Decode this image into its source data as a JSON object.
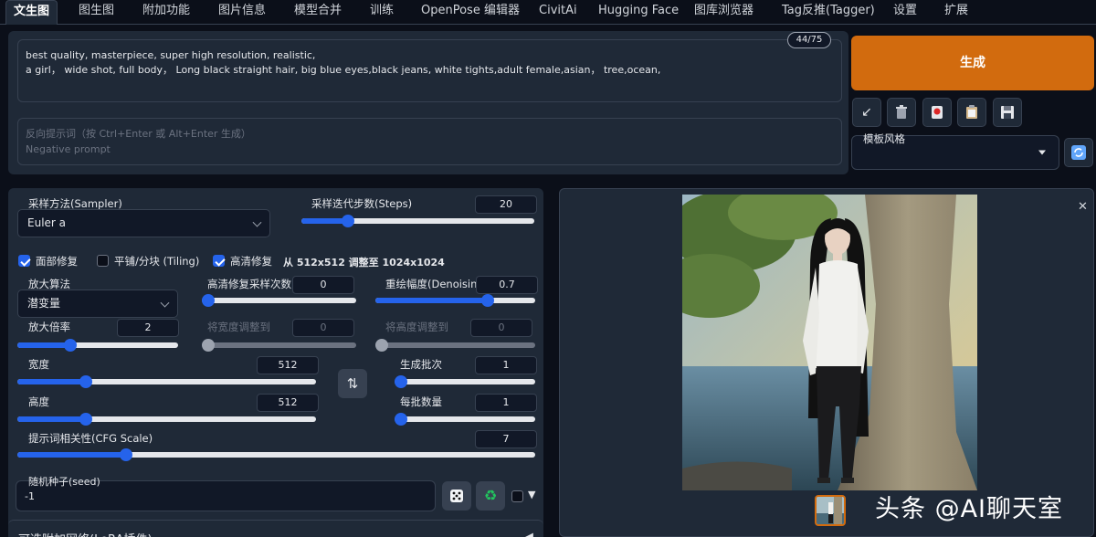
{
  "tabs": [
    {
      "label": "文生图"
    },
    {
      "label": "图生图"
    },
    {
      "label": "附加功能"
    },
    {
      "label": "图片信息"
    },
    {
      "label": "模型合并"
    },
    {
      "label": "训练"
    },
    {
      "label": "OpenPose 编辑器"
    },
    {
      "label": "CivitAi"
    },
    {
      "label": "Hugging Face"
    },
    {
      "label": "图库浏览器"
    },
    {
      "label": "Tag反推(Tagger)"
    },
    {
      "label": "设置"
    },
    {
      "label": "扩展"
    }
  ],
  "prompt": {
    "line1": "best quality, masterpiece, super high resolution, realistic,",
    "line2": "a girl， wide shot, full body， Long black straight hair, big blue eyes,black jeans, white tights,adult female,asian， tree,ocean,",
    "token_counter": "44/75"
  },
  "negative_prompt": {
    "placeholder_line1": "反向提示词（按 Ctrl+Enter 或 Alt+Enter 生成）",
    "placeholder_line2": "Negative prompt"
  },
  "generate_label": "生成",
  "toolbar_icons": [
    "arrow-icon",
    "trash-icon",
    "record-icon",
    "clipboard-icon",
    "save-icon"
  ],
  "style": {
    "label": "模板风格",
    "value": ""
  },
  "sampler": {
    "label": "采样方法(Sampler)",
    "value": "Euler a"
  },
  "steps": {
    "label": "采样迭代步数(Steps)",
    "value": "20",
    "fraction": 0.2
  },
  "checks": {
    "face_restore": {
      "label": "面部修复",
      "checked": true
    },
    "tiling": {
      "label": "平铺/分块 (Tiling)",
      "checked": false
    },
    "hires": {
      "label": "高清修复",
      "checked": true
    },
    "hires_info": "从 512x512 调整至 1024x1024"
  },
  "upscaler": {
    "label": "放大算法",
    "value": "潜变量"
  },
  "hires_steps": {
    "label": "高清修复采样次数",
    "value": "0",
    "fraction": 0.0
  },
  "denoising": {
    "label": "重绘幅度(Denoising)",
    "value": "0.7",
    "fraction": 0.7
  },
  "upscale_by": {
    "label": "放大倍率",
    "value": "2",
    "fraction": 0.33
  },
  "resize_width": {
    "label": "将宽度调整到",
    "value": "0",
    "fraction": 0.0
  },
  "resize_height": {
    "label": "将高度调整到",
    "value": "0",
    "fraction": 0.0
  },
  "width": {
    "label": "宽度",
    "value": "512",
    "fraction": 0.23
  },
  "height": {
    "label": "高度",
    "value": "512",
    "fraction": 0.23
  },
  "batch_count": {
    "label": "生成批次",
    "value": "1",
    "fraction": 0.0
  },
  "batch_size": {
    "label": "每批数量",
    "value": "1",
    "fraction": 0.0
  },
  "cfg": {
    "label": "提示词相关性(CFG Scale)",
    "value": "7",
    "fraction": 0.21
  },
  "seed": {
    "label": "随机种子(seed)",
    "value": "-1"
  },
  "extra_networks_label": "可选附加网络(LoRA插件)",
  "watermark": "头条 @AI聊天室"
}
